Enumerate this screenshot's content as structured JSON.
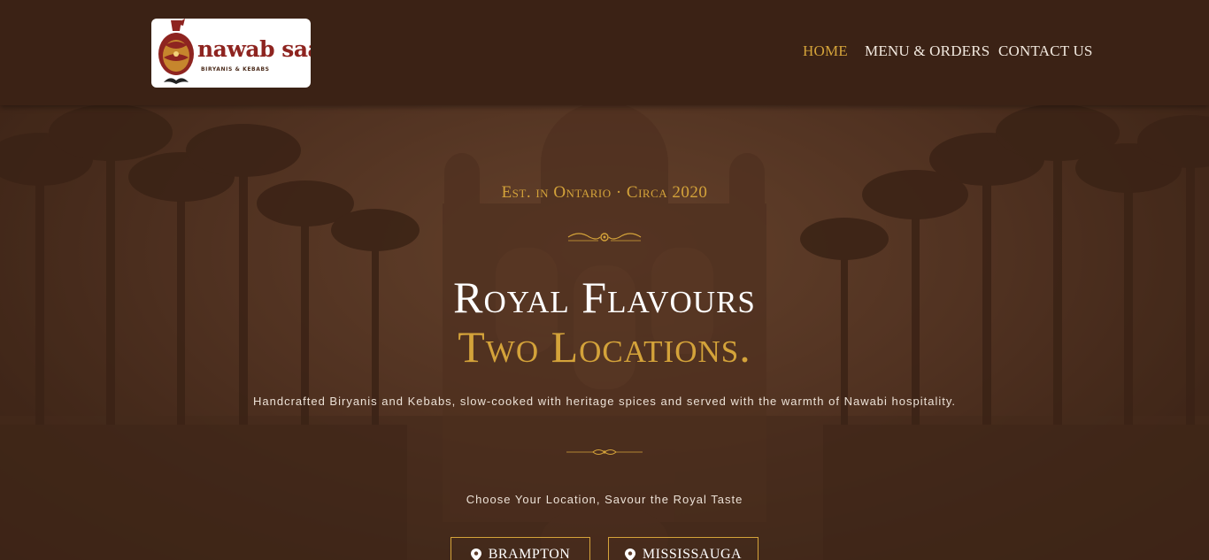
{
  "header": {
    "logo": {
      "name": "nawab saab",
      "tagline": "BIRYANIS & KEBABS"
    },
    "nav": [
      {
        "label": "HOME",
        "active": true
      },
      {
        "label": "MENU & ORDERS",
        "active": false
      },
      {
        "label": "CONTACT US",
        "active": false
      }
    ]
  },
  "hero": {
    "established": "Est. in Ontario · Circa 2020",
    "title_line1": "Royal Flavours",
    "title_line2": "Two Locations.",
    "tagline": "Handcrafted Biryanis and Kebabs, slow-cooked with heritage spices and served with the warmth of Nawabi hospitality.",
    "choose_prompt": "Choose Your Location, Savour the Royal Taste",
    "locations": [
      {
        "label": "BRAMPTON",
        "icon": "map-pin-icon"
      },
      {
        "label": "MISSISSAUGA",
        "icon": "map-pin-icon"
      }
    ]
  },
  "colors": {
    "accent_gold": "#d4a33a",
    "header_bg": "#3b2215",
    "logo_red": "#8e2420",
    "text_light": "#f2e9df"
  }
}
